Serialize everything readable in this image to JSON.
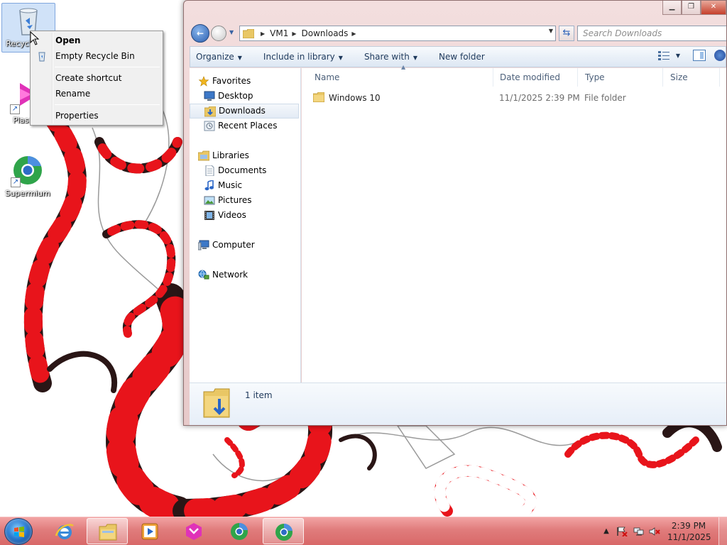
{
  "desktop": {
    "icons": [
      {
        "label": "Recycle Bin",
        "name": "recycle-bin"
      },
      {
        "label": "Plasma",
        "name": "plasma"
      },
      {
        "label": "Supermium",
        "name": "supermium"
      }
    ]
  },
  "context_menu": {
    "items": [
      {
        "label": "Open",
        "bold": true
      },
      {
        "label": "Empty Recycle Bin"
      },
      {
        "label": "Create shortcut"
      },
      {
        "label": "Rename"
      },
      {
        "label": "Properties"
      }
    ]
  },
  "explorer": {
    "breadcrumb": [
      "VM1",
      "Downloads"
    ],
    "search_placeholder": "Search Downloads",
    "commands": {
      "organize": "Organize",
      "include_in_library": "Include in library",
      "share_with": "Share with",
      "new_folder": "New folder"
    },
    "nav": {
      "favorites": "Favorites",
      "desktop": "Desktop",
      "downloads": "Downloads",
      "recent_places": "Recent Places",
      "libraries": "Libraries",
      "documents": "Documents",
      "music": "Music",
      "pictures": "Pictures",
      "videos": "Videos",
      "computer": "Computer",
      "network": "Network"
    },
    "columns": {
      "name": "Name",
      "date_modified": "Date modified",
      "type": "Type",
      "size": "Size"
    },
    "files": [
      {
        "name": "Windows 10",
        "date_modified": "11/1/2025 2:39 PM",
        "type": "File folder",
        "size": ""
      }
    ],
    "details": {
      "count": "1 item"
    }
  },
  "taskbar": {
    "time": "2:39 PM",
    "date": "11/1/2025"
  },
  "colors": {
    "taskbar": "#e07c7c",
    "wallpaper_red": "#e8141b",
    "wallpaper_dark": "#2a1616",
    "window_frame": "#ecd2d2"
  }
}
